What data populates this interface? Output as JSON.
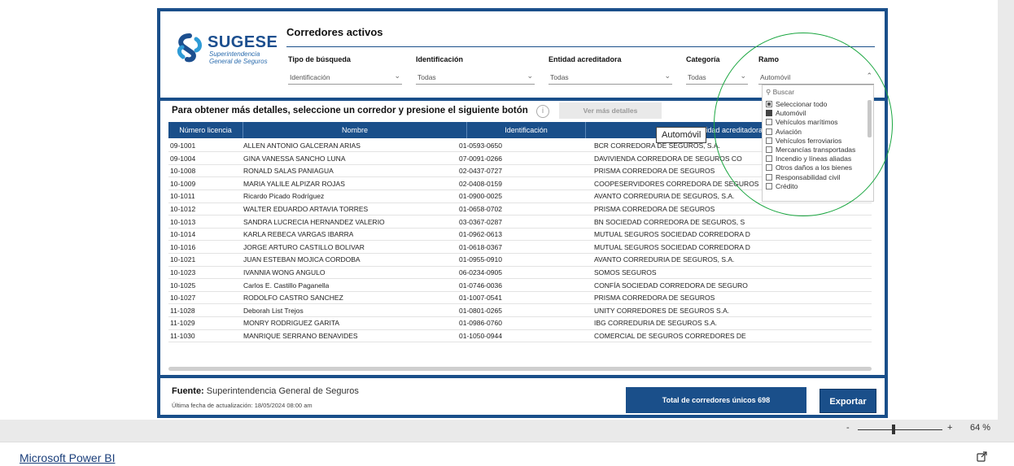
{
  "logo": {
    "name": "SUGESE",
    "subtitle_line1": "Superintendencia",
    "subtitle_line2": "General de Seguros"
  },
  "report": {
    "title": "Corredores activos",
    "details_prompt": "Para obtener más detalles, seleccione un corredor y presione el siguiente botón",
    "details_button": "Ver más detalles"
  },
  "filters": [
    {
      "label": "Tipo de búsqueda",
      "value": "Identificación"
    },
    {
      "label": "Identificación",
      "value": "Todas"
    },
    {
      "label": "Entidad acreditadora",
      "value": "Todas"
    },
    {
      "label": "Categoría",
      "value": "Todas"
    },
    {
      "label": "Ramo",
      "value": "Automóvil"
    }
  ],
  "ramo_dropdown": {
    "search_placeholder": "Buscar",
    "items": [
      {
        "label": "Seleccionar todo",
        "state": "partial"
      },
      {
        "label": "Automóvil",
        "state": "checked"
      },
      {
        "label": "Vehículos marítimos",
        "state": "unchecked"
      },
      {
        "label": "Aviación",
        "state": "unchecked"
      },
      {
        "label": "Vehículos ferroviarios",
        "state": "unchecked"
      },
      {
        "label": "Mercancías transportadas",
        "state": "unchecked"
      },
      {
        "label": "Incendio y líneas aliadas",
        "state": "unchecked"
      },
      {
        "label": "Otros daños a los bienes",
        "state": "unchecked"
      },
      {
        "label": "Responsabilidad civil",
        "state": "unchecked"
      },
      {
        "label": "Crédito",
        "state": "unchecked"
      }
    ],
    "tooltip": "Automóvil"
  },
  "table": {
    "columns": [
      "Número licencia",
      "Nombre",
      "Identificación",
      "Entidad acreditadora"
    ],
    "rows": [
      [
        "09-1001",
        "ALLEN ANTONIO GALCERAN ARIAS",
        "01-0593-0650",
        "BCR CORREDORA DE SEGUROS, S.A."
      ],
      [
        "09-1004",
        "GINA VANESSA SANCHO LUNA",
        "07-0091-0266",
        "DAVIVIENDA CORREDORA DE SEGUROS CO"
      ],
      [
        "10-1008",
        "RONALD SALAS PANIAGUA",
        "02-0437-0727",
        "PRISMA CORREDORA DE SEGUROS"
      ],
      [
        "10-1009",
        "MARIA YALILE ALPIZAR ROJAS",
        "02-0408-0159",
        "COOPESERVIDORES CORREDORA DE SEGUROS"
      ],
      [
        "10-1011",
        "Ricardo Picado Rodríguez",
        "01-0900-0025",
        "AVANTO CORREDURIA DE SEGUROS, S.A."
      ],
      [
        "10-1012",
        "WALTER EDUARDO ARTAVIA TORRES",
        "01-0658-0702",
        "PRISMA CORREDORA DE SEGUROS"
      ],
      [
        "10-1013",
        "SANDRA LUCRECIA HERNANDEZ VALERIO",
        "03-0367-0287",
        "BN SOCIEDAD CORREDORA DE SEGUROS, S"
      ],
      [
        "10-1014",
        "KARLA REBECA VARGAS IBARRA",
        "01-0962-0613",
        "MUTUAL SEGUROS SOCIEDAD CORREDORA D"
      ],
      [
        "10-1016",
        "JORGE ARTURO CASTILLO BOLIVAR",
        "01-0618-0367",
        "MUTUAL SEGUROS SOCIEDAD CORREDORA D"
      ],
      [
        "10-1021",
        "JUAN ESTEBAN MOJICA CORDOBA",
        "01-0955-0910",
        "AVANTO CORREDURIA DE SEGUROS, S.A."
      ],
      [
        "10-1023",
        "IVANNIA WONG ANGULO",
        "06-0234-0905",
        "SOMOS SEGUROS"
      ],
      [
        "10-1025",
        "Carlos E. Castillo Paganella",
        "01-0746-0036",
        "CONFÍA SOCIEDAD CORREDORA DE SEGURO"
      ],
      [
        "10-1027",
        "RODOLFO CASTRO SANCHEZ",
        "01-1007-0541",
        "PRISMA CORREDORA DE SEGUROS"
      ],
      [
        "11-1028",
        "Deborah List Trejos",
        "01-0801-0265",
        "UNITY CORREDORES DE SEGUROS S.A."
      ],
      [
        "11-1029",
        "MONRY RODRIGUEZ GARITA",
        "01-0986-0760",
        "IBG CORREDURIA DE SEGUROS S.A."
      ],
      [
        "11-1030",
        "MANRIQUE SERRANO BENAVIDES",
        "01-1050-0944",
        "COMERCIAL DE SEGUROS CORREDORES DE"
      ]
    ]
  },
  "footer": {
    "fuente_label": "Fuente:",
    "fuente_value": "Superintendencia General de Seguros",
    "fecha": "Última fecha de actualización: 18/05/2024 08:00 am",
    "total": "Total de corredores únicos 698",
    "export": "Exportar"
  },
  "zoom": {
    "minus": "-",
    "plus": "+",
    "percent": "64 %"
  },
  "bottom": {
    "link": "Microsoft Power BI"
  },
  "colors": {
    "accent": "#1a4f8a",
    "highlight_circle": "#1aa640"
  }
}
